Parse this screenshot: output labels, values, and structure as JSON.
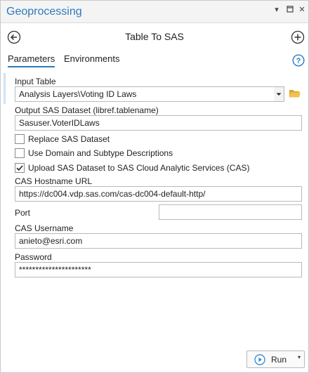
{
  "window": {
    "title": "Geoprocessing",
    "controls": {
      "menu": "▾",
      "pin": "⊓",
      "close": "✕"
    }
  },
  "nav": {
    "back_icon": "arrow-left-circle-icon",
    "tool_title": "Table To SAS",
    "add_icon": "plus-circle-icon"
  },
  "tabs": [
    {
      "label": "Parameters",
      "active": true
    },
    {
      "label": "Environments",
      "active": false
    }
  ],
  "help_icon": "question-circle-icon",
  "params": {
    "input_table": {
      "label": "Input Table",
      "value": "Analysis Layers\\Voting ID Laws"
    },
    "output_dataset": {
      "label": "Output SAS Dataset (libref.tablename)",
      "value": "Sasuser.VoterIDLaws"
    },
    "replace": {
      "label": "Replace SAS Dataset",
      "checked": false
    },
    "use_domain": {
      "label": "Use Domain and Subtype Descriptions",
      "checked": false
    },
    "upload": {
      "label": "Upload SAS Dataset to SAS Cloud Analytic Services (CAS)",
      "checked": true
    },
    "cas_url": {
      "label": "CAS Hostname URL",
      "value": "https://dc004.vdp.sas.com/cas-dc004-default-http/"
    },
    "port": {
      "label": "Port",
      "value": ""
    },
    "username": {
      "label": "CAS Username",
      "value": "anieto@esri.com"
    },
    "password": {
      "label": "Password",
      "value": "**********************"
    }
  },
  "footer": {
    "run_label": "Run"
  },
  "colors": {
    "accent": "#2b7bbd",
    "run_icon": "#3b8fd6",
    "folder": "#e8b53a"
  }
}
